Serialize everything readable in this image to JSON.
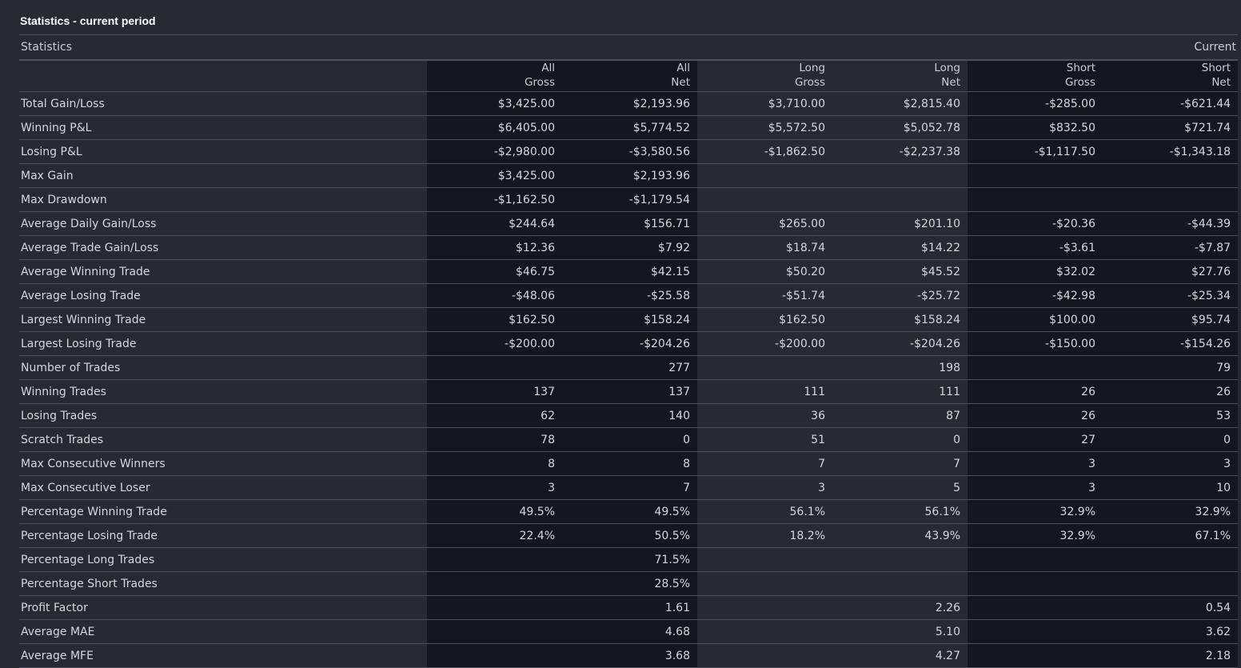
{
  "panel_title": "Statistics - current period",
  "section": {
    "left_label": "Statistics",
    "right_label": "Current"
  },
  "columns": [
    {
      "line1": "All",
      "line2": "Gross"
    },
    {
      "line1": "All",
      "line2": "Net"
    },
    {
      "line1": "Long",
      "line2": "Gross"
    },
    {
      "line1": "Long",
      "line2": "Net"
    },
    {
      "line1": "Short",
      "line2": "Gross"
    },
    {
      "line1": "Short",
      "line2": "Net"
    }
  ],
  "rows": [
    {
      "label": "Total Gain/Loss",
      "values": [
        "$3,425.00",
        "$2,193.96",
        "$3,710.00",
        "$2,815.40",
        "-$285.00",
        "-$621.44"
      ]
    },
    {
      "label": "Winning P&L",
      "values": [
        "$6,405.00",
        "$5,774.52",
        "$5,572.50",
        "$5,052.78",
        "$832.50",
        "$721.74"
      ]
    },
    {
      "label": "Losing P&L",
      "values": [
        "-$2,980.00",
        "-$3,580.56",
        "-$1,862.50",
        "-$2,237.38",
        "-$1,117.50",
        "-$1,343.18"
      ]
    },
    {
      "label": "Max Gain",
      "values": [
        "$3,425.00",
        "$2,193.96",
        "",
        "",
        "",
        ""
      ]
    },
    {
      "label": "Max Drawdown",
      "values": [
        "-$1,162.50",
        "-$1,179.54",
        "",
        "",
        "",
        ""
      ]
    },
    {
      "label": "Average Daily Gain/Loss",
      "values": [
        "$244.64",
        "$156.71",
        "$265.00",
        "$201.10",
        "-$20.36",
        "-$44.39"
      ]
    },
    {
      "label": "Average Trade Gain/Loss",
      "values": [
        "$12.36",
        "$7.92",
        "$18.74",
        "$14.22",
        "-$3.61",
        "-$7.87"
      ]
    },
    {
      "label": "Average Winning Trade",
      "values": [
        "$46.75",
        "$42.15",
        "$50.20",
        "$45.52",
        "$32.02",
        "$27.76"
      ]
    },
    {
      "label": "Average Losing Trade",
      "values": [
        "-$48.06",
        "-$25.58",
        "-$51.74",
        "-$25.72",
        "-$42.98",
        "-$25.34"
      ]
    },
    {
      "label": "Largest Winning Trade",
      "values": [
        "$162.50",
        "$158.24",
        "$162.50",
        "$158.24",
        "$100.00",
        "$95.74"
      ]
    },
    {
      "label": "Largest Losing Trade",
      "values": [
        "-$200.00",
        "-$204.26",
        "-$200.00",
        "-$204.26",
        "-$150.00",
        "-$154.26"
      ]
    },
    {
      "label": "Number of Trades",
      "values": [
        "",
        "277",
        "",
        "198",
        "",
        "79"
      ]
    },
    {
      "label": "Winning Trades",
      "values": [
        "137",
        "137",
        "111",
        "111",
        "26",
        "26"
      ]
    },
    {
      "label": "Losing Trades",
      "values": [
        "62",
        "140",
        "36",
        "87",
        "26",
        "53"
      ]
    },
    {
      "label": "Scratch Trades",
      "values": [
        "78",
        "0",
        "51",
        "0",
        "27",
        "0"
      ]
    },
    {
      "label": "Max Consecutive Winners",
      "values": [
        "8",
        "8",
        "7",
        "7",
        "3",
        "3"
      ]
    },
    {
      "label": "Max Consecutive Loser",
      "values": [
        "3",
        "7",
        "3",
        "5",
        "3",
        "10"
      ]
    },
    {
      "label": "Percentage Winning Trade",
      "values": [
        "49.5%",
        "49.5%",
        "56.1%",
        "56.1%",
        "32.9%",
        "32.9%"
      ]
    },
    {
      "label": "Percentage Losing Trade",
      "values": [
        "22.4%",
        "50.5%",
        "18.2%",
        "43.9%",
        "32.9%",
        "67.1%"
      ]
    },
    {
      "label": "Percentage Long Trades",
      "values": [
        "",
        "71.5%",
        "",
        "",
        "",
        ""
      ]
    },
    {
      "label": "Percentage Short Trades",
      "values": [
        "",
        "28.5%",
        "",
        "",
        "",
        ""
      ]
    },
    {
      "label": "Profit Factor",
      "values": [
        "",
        "1.61",
        "",
        "2.26",
        "",
        "0.54"
      ]
    },
    {
      "label": "Average MAE",
      "values": [
        "",
        "4.68",
        "",
        "5.10",
        "",
        "3.62"
      ]
    },
    {
      "label": "Average MFE",
      "values": [
        "",
        "3.68",
        "",
        "4.27",
        "",
        "2.18"
      ]
    }
  ],
  "colors": {
    "background": "#252a33",
    "dark_column": "#141720",
    "grid_line": "#4b515c",
    "text": "#d4d8de",
    "title": "#ffffff"
  }
}
